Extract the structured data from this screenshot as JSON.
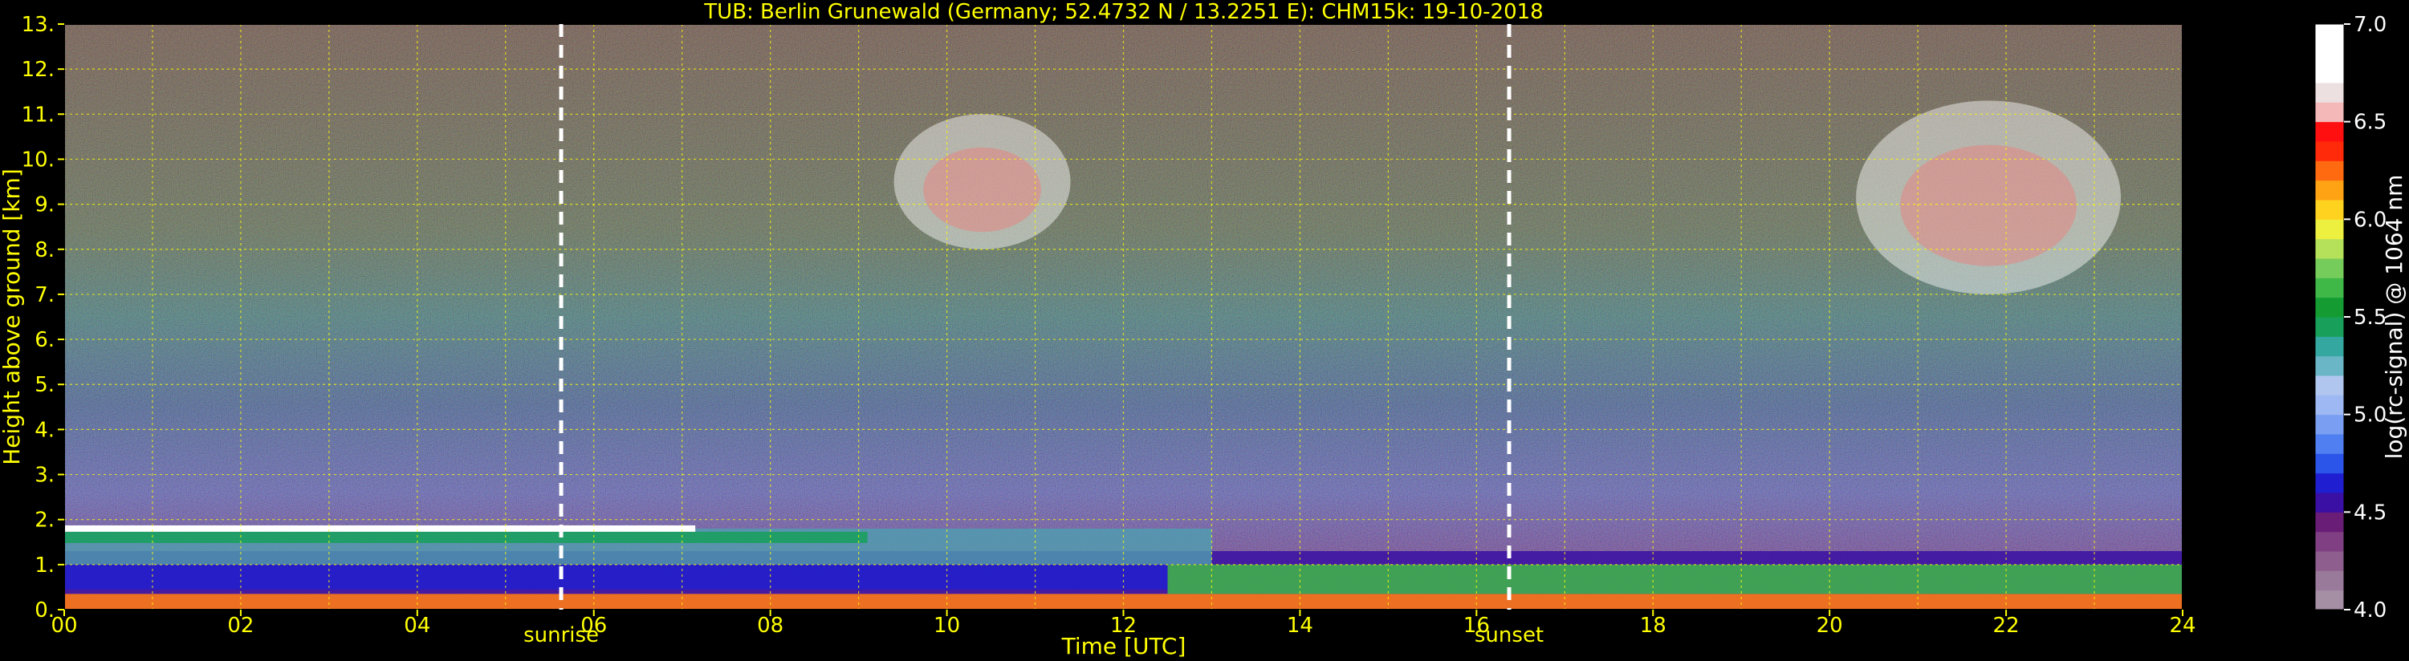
{
  "chart_data": {
    "type": "heatmap",
    "title": "TUB: Berlin Grunewald (Germany; 52.4732 N / 13.2251 E):    CHM15k: 19-10-2018",
    "xlabel": "Time [UTC]",
    "ylabel": "Height above ground [km]",
    "xlim": [
      0,
      24
    ],
    "ylim": [
      0,
      13
    ],
    "xticks": [
      "00",
      "02",
      "04",
      "06",
      "08",
      "10",
      "12",
      "14",
      "16",
      "18",
      "20",
      "22",
      "24"
    ],
    "yticks": [
      "0.",
      "1.",
      "2.",
      "3.",
      "4.",
      "5.",
      "6.",
      "7.",
      "8.",
      "9.",
      "10.",
      "11.",
      "12.",
      "13."
    ],
    "grid": true,
    "markers": [
      {
        "label": "sunrise",
        "x": 5.63
      },
      {
        "label": "sunset",
        "x": 16.37
      }
    ],
    "colorbar": {
      "label": "log(rc-signal) @ 1064 nm",
      "range": [
        4.0,
        7.0
      ],
      "ticks": [
        "4.0",
        "4.5",
        "5.0",
        "5.5",
        "6.0",
        "6.5",
        "7.0"
      ],
      "colors": [
        "#a58fa5",
        "#9a7a9a",
        "#8e5f8e",
        "#7f3f82",
        "#6a1d76",
        "#3a0fa3",
        "#1f1fd1",
        "#2a55e8",
        "#4f7ff0",
        "#7a9ff2",
        "#9db8f2",
        "#b0c6ef",
        "#6ab5c6",
        "#33a7a0",
        "#18a05a",
        "#149c32",
        "#3fb848",
        "#76cc5a",
        "#b5e05a",
        "#eef040",
        "#ffd21f",
        "#ffa214",
        "#ff6a10",
        "#ff2a0a",
        "#ff0f0f",
        "#f4b8b8",
        "#ece0e0",
        "#ffffff",
        "#ffffff",
        "#ffffff"
      ]
    },
    "layers": [
      {
        "name": "aerosol-layer",
        "time_start": 0,
        "time_end": 24,
        "height_top": 1.3
      },
      {
        "name": "residual-layer",
        "time_start": 0,
        "time_end": 13,
        "height_top": 1.8
      },
      {
        "name": "cirrus-1",
        "time_start": 9.4,
        "time_end": 11.4,
        "height_bottom": 8.0,
        "height_top": 11.0
      },
      {
        "name": "cirrus-2",
        "time_start": 20.3,
        "time_end": 23.3,
        "height_bottom": 7.0,
        "height_top": 11.3
      }
    ]
  }
}
